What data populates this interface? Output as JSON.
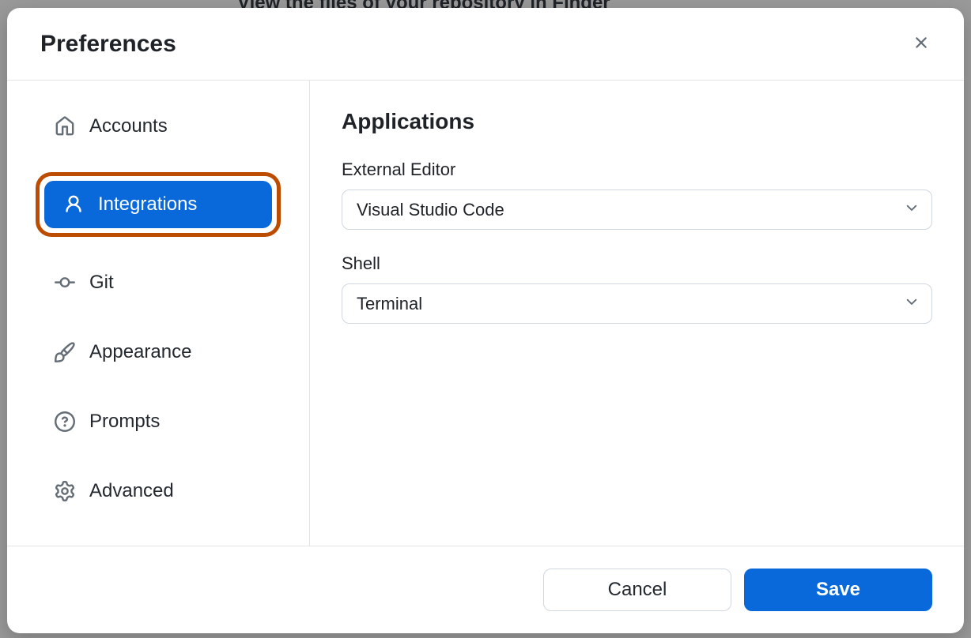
{
  "backdrop_text": "View the files of your repository in Finder",
  "modal": {
    "title": "Preferences",
    "sidebar": {
      "items": [
        {
          "label": "Accounts"
        },
        {
          "label": "Integrations"
        },
        {
          "label": "Git"
        },
        {
          "label": "Appearance"
        },
        {
          "label": "Prompts"
        },
        {
          "label": "Advanced"
        }
      ]
    },
    "content": {
      "title": "Applications",
      "editor_label": "External Editor",
      "editor_value": "Visual Studio Code",
      "shell_label": "Shell",
      "shell_value": "Terminal"
    },
    "footer": {
      "cancel": "Cancel",
      "save": "Save"
    }
  }
}
